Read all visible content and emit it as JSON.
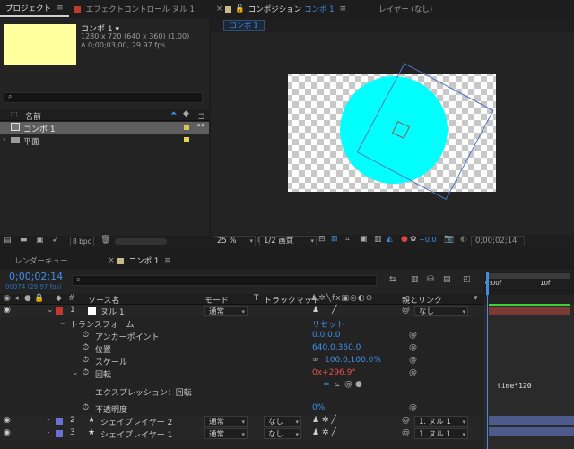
{
  "project_panel": {
    "tab_project": "プロジェクト",
    "tab_effects": "エフェクトコントロール ヌル 1",
    "comp_name": "コンポ 1",
    "comp_dims": "1280 x 720  (640 x 360) (1.00)",
    "comp_duration": "Δ 0;00;03;00, 29.97 fps",
    "search_placeholder": "",
    "col_name": "名前",
    "items": [
      {
        "name": "コンポ 1",
        "color": "#d8c45e"
      },
      {
        "name": "平面",
        "color": "#e8d44f"
      }
    ],
    "bpc": "8 bpc"
  },
  "viewer": {
    "tab_label": "コンポジション",
    "tab_comp": "コンポ 1",
    "layer_tab": "レイヤー (なし)",
    "breadcrumb": "コンポ 1",
    "zoom": "25 %",
    "quality": "1/2 画質",
    "exposure": "+0.0",
    "timecode": "0;00;02;14"
  },
  "timeline": {
    "tab_render": "レンダーキュー",
    "tab_comp": "コンポ 1",
    "timecode": "0;00;02;14",
    "frames": "00074 (29.97 fps)",
    "ruler_start": "0:00f",
    "ruler_mark": "10f",
    "col_source": "ソース名",
    "col_mode": "モード",
    "col_t": "T",
    "col_trackmatte": "トラックマット",
    "col_parent": "親とリンク",
    "layers": [
      {
        "num": "1",
        "name": "ヌル 1",
        "mode": "通常",
        "parent": "なし",
        "color": "#c0392b"
      },
      {
        "num": "2",
        "name": "シェイプレイヤー 2",
        "mode": "通常",
        "trk": "なし",
        "parent": "1. ヌル 1",
        "color": "#6b6fd6"
      },
      {
        "num": "3",
        "name": "シェイプレイヤー 1",
        "mode": "通常",
        "trk": "なし",
        "parent": "1. ヌル 1",
        "color": "#6b6fd6"
      }
    ],
    "transform": "トランスフォーム",
    "reset": "リセット",
    "props": [
      {
        "name": "アンカーポイント",
        "value": "0.0,0.0"
      },
      {
        "name": "位置",
        "value": "640.0,360.0"
      },
      {
        "name": "スケール",
        "value": "100.0,100.0%"
      },
      {
        "name": "回転",
        "value": "0x+296.9°"
      },
      {
        "name": "不透明度",
        "value": "0%"
      }
    ],
    "expression_label": "エクスプレッション：回転",
    "expression": "time*120"
  },
  "colors": {
    "accent": "#3f8ee6",
    "cyan": "#00ffff",
    "comp_swatch": "#ffff9e",
    "rotation_red": "#e0504a",
    "null_bar": "#7a3a36",
    "shape_bar": "#4e5a8c"
  }
}
